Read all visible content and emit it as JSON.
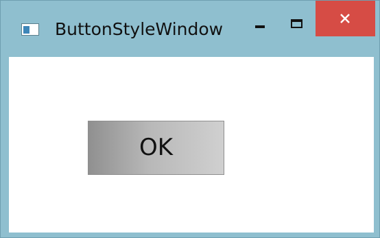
{
  "window": {
    "title": "ButtonStyleWindow",
    "icon": "window-app-icon",
    "controls": {
      "minimize_icon": "minimize-icon",
      "maximize_icon": "maximize-icon",
      "close_icon": "close-icon"
    }
  },
  "content": {
    "ok_button_label": "OK"
  },
  "colors": {
    "title_bar": "#8fbfcf",
    "close_button": "#d64c45",
    "client_background": "#ffffff",
    "button_gradient": [
      "#909090",
      "#d0d0d0"
    ]
  }
}
